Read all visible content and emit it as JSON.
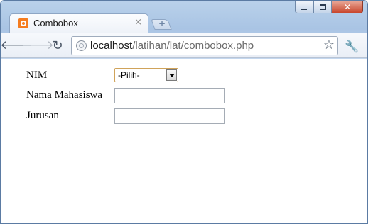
{
  "browser": {
    "tab_title": "Combobox",
    "tab_close": "×",
    "new_tab": "+",
    "url_host": "localhost",
    "url_path": "/latihan/lat/combobox.php",
    "icons": {
      "back": "back-arrow-icon",
      "forward": "forward-arrow-icon",
      "reload": "reload-icon",
      "bookmark": "star-icon",
      "menu": "wrench-icon"
    }
  },
  "form": {
    "nim_label": "NIM",
    "nim_select_value": "-Pilih-",
    "nama_label": "Nama Mahasiswa",
    "nama_value": "",
    "jurusan_label": "Jurusan",
    "jurusan_value": ""
  }
}
